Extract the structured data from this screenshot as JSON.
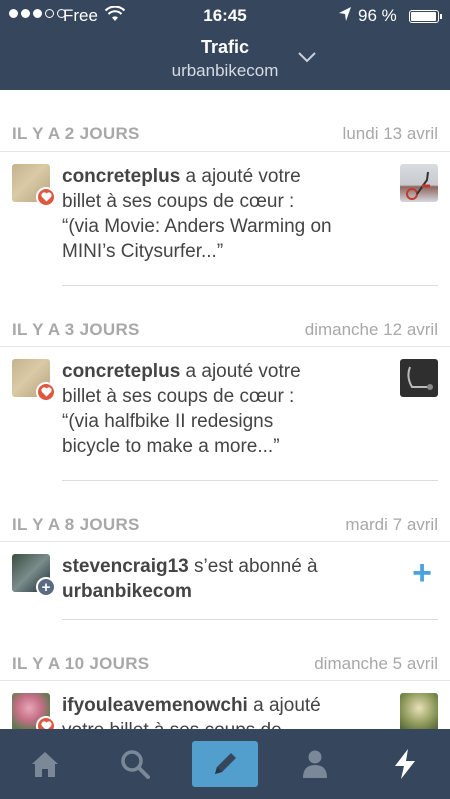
{
  "status_bar": {
    "carrier": "Free",
    "time": "16:45",
    "battery_pct": "96 %",
    "battery_level": 0.96,
    "signal_bars": 3,
    "signal_total": 5
  },
  "header": {
    "title": "Trafic",
    "subtitle": "urbanbikecom"
  },
  "sections": [
    {
      "relative": "IL Y A 2 JOURS",
      "date": "lundi 13 avril",
      "item": {
        "username": "concreteplus",
        "line1_rest": " a ajouté votre",
        "line2": "billet à ses coups de cœur :",
        "line3": "“(via Movie: Anders Warming on",
        "line4": "MINI’s Citysurfer...”"
      }
    },
    {
      "relative": "IL Y A 3 JOURS",
      "date": "dimanche 12 avril",
      "item": {
        "username": "concreteplus",
        "line1_rest": " a ajouté votre",
        "line2": "billet à ses coups de cœur :",
        "line3": "“(via halfbike II redesigns",
        "line4": "bicycle to make a more...”"
      }
    },
    {
      "relative": "IL Y A 8 JOURS",
      "date": "mardi 7 avril",
      "item": {
        "username": "stevencraig13",
        "line1_rest": " s’est abonné à",
        "line2_bold": "urbanbikecom",
        "plus": "+"
      }
    },
    {
      "relative": "IL Y A 10 JOURS",
      "date": "dimanche 5 avril",
      "item": {
        "username": "ifyouleavemenowchi",
        "line1_rest": " a ajouté",
        "line2": "votre billet à ses coups de"
      }
    }
  ],
  "icons": {
    "like_badge": "heart-icon",
    "follow_badge": "plus-icon"
  },
  "tabbar": {
    "tabs": [
      "home-icon",
      "search-icon",
      "compose-icon",
      "account-icon",
      "activity-icon"
    ],
    "active": "compose-icon"
  },
  "colors": {
    "navbar": "#36465d",
    "accent_blue": "#529ecc",
    "like_red": "#e0573f",
    "follow_plus": "#4aa3df"
  }
}
